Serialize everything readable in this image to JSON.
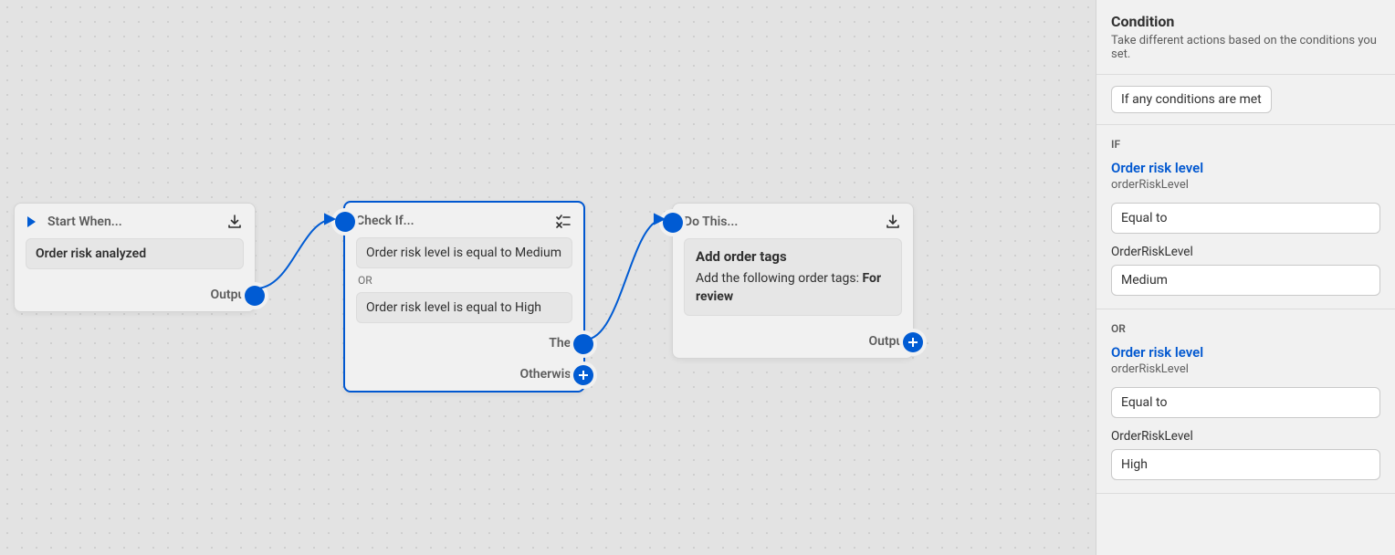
{
  "nodes": {
    "start": {
      "title": "Start When...",
      "event": "Order risk analyzed",
      "output_label": "Output"
    },
    "check": {
      "title": "Check If...",
      "cond1": "Order risk level is equal to Medium",
      "or": "OR",
      "cond2": "Order risk level is equal to High",
      "then_label": "Then",
      "otherwise_label": "Otherwise"
    },
    "action": {
      "title": "Do This...",
      "action_title": "Add order tags",
      "action_desc_prefix": "Add the following order tags: ",
      "action_desc_bold": "For review",
      "output_label": "Output"
    }
  },
  "panel": {
    "title": "Condition",
    "subtitle": "Take different actions based on the conditions you set.",
    "mode": "If any conditions are met",
    "if_label": "IF",
    "or_label": "OR",
    "cond1": {
      "link": "Order risk level",
      "sublink": "orderRiskLevel",
      "operator": "Equal to",
      "field_label": "OrderRiskLevel",
      "value": "Medium"
    },
    "cond2": {
      "link": "Order risk level",
      "sublink": "orderRiskLevel",
      "operator": "Equal to",
      "field_label": "OrderRiskLevel",
      "value": "High"
    }
  }
}
